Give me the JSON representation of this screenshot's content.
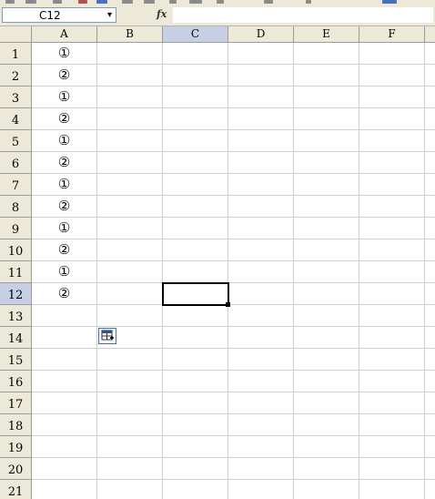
{
  "formula_bar": {
    "name_box": "C12",
    "name_box_arrow": "▾",
    "fx_label": "fx",
    "formula": ""
  },
  "columns": [
    "A",
    "B",
    "C",
    "D",
    "E",
    "F"
  ],
  "rows": [
    "1",
    "2",
    "3",
    "4",
    "5",
    "6",
    "7",
    "8",
    "9",
    "10",
    "11",
    "12",
    "13",
    "14",
    "15",
    "16",
    "17",
    "18",
    "19",
    "20",
    "21"
  ],
  "cells": {
    "A1": "①",
    "A2": "②",
    "A3": "①",
    "A4": "②",
    "A5": "①",
    "A6": "②",
    "A7": "①",
    "A8": "②",
    "A9": "①",
    "A10": "②",
    "A11": "①",
    "A12": "②"
  },
  "active_cell": "C12",
  "colors": {
    "chrome": "#ece9d8",
    "header_active": "#c6cfe4",
    "gridline": "#d0d0d0"
  },
  "icons": {
    "fx": "function-icon",
    "paste_options": "auto-fill-options-icon"
  }
}
